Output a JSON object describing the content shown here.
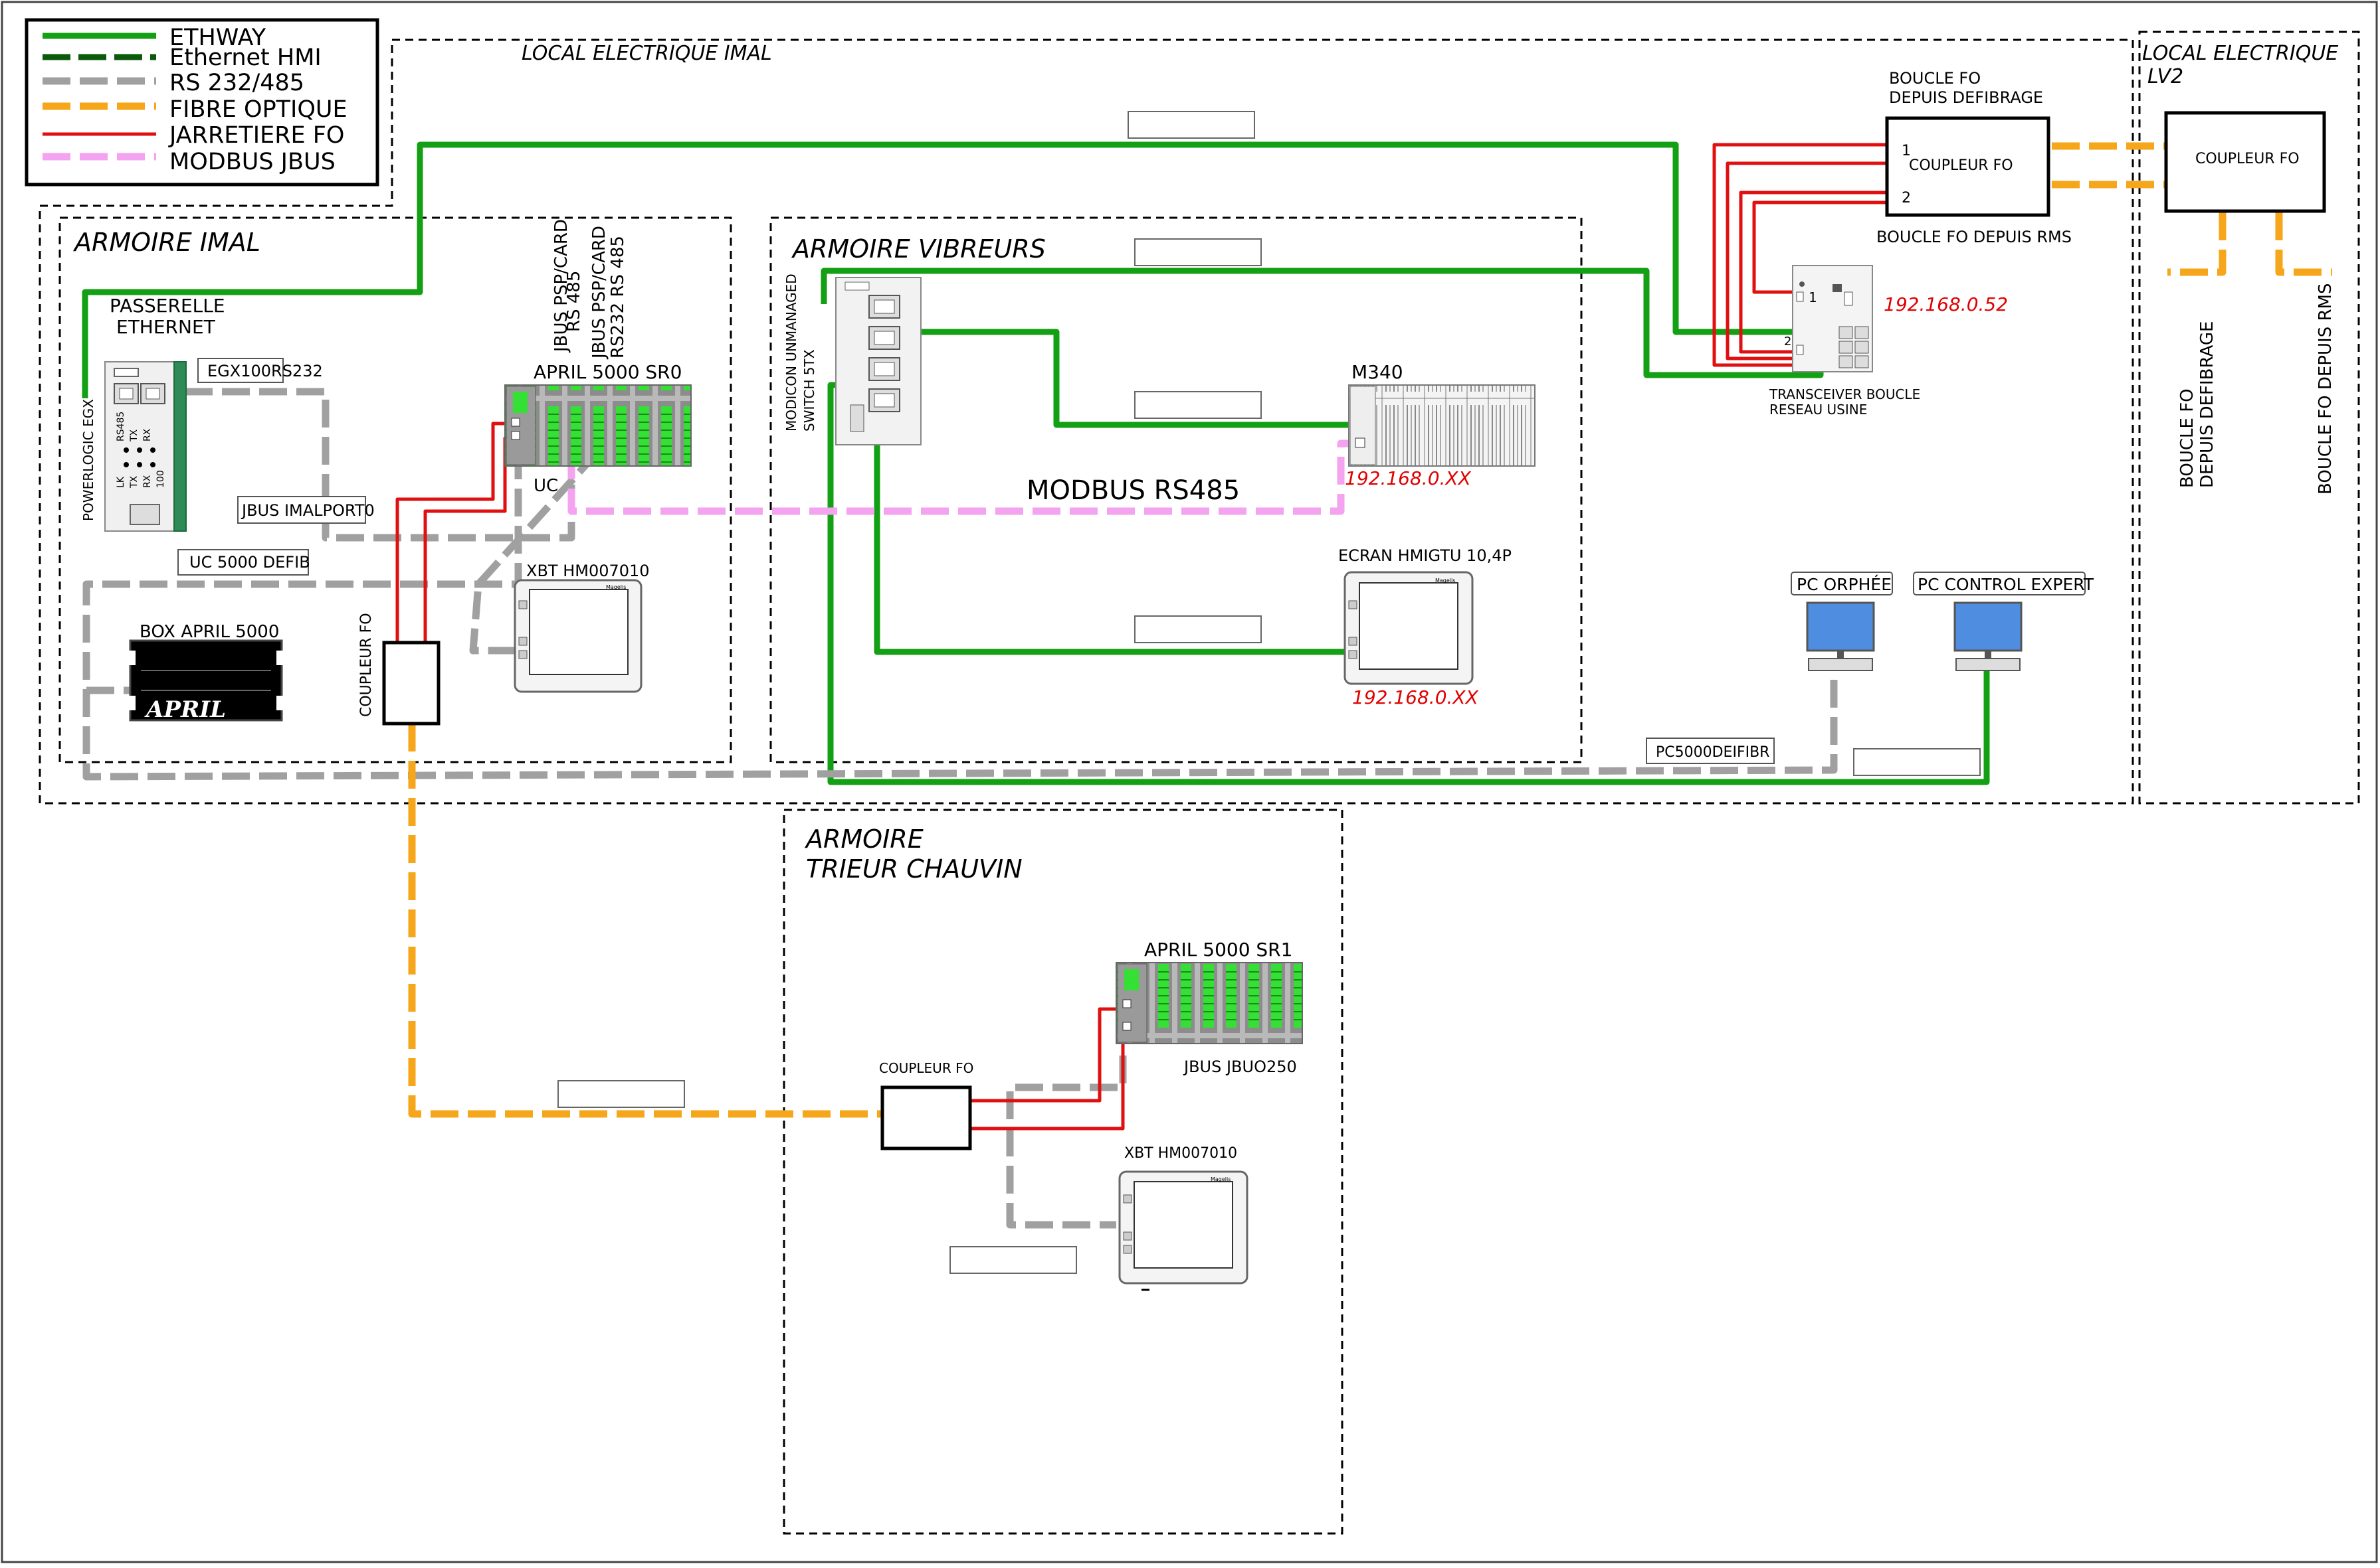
{
  "colors": {
    "ethway": "#14a014",
    "ethernet_hmi": "#0b5a0b",
    "rs232_485": "#a0a0a0",
    "fibre_optique": "#f5a61a",
    "jarretiere_fo": "#e01010",
    "modbus_jbus": "#f4a3f0",
    "ip_text": "#e00000"
  },
  "legend": {
    "ethway": "ETHWAY",
    "ethernet_hmi": "Ethernet HMI",
    "rs232_485": "RS 232/485",
    "fibre_optique": "FIBRE OPTIQUE",
    "jarretiere_fo": "JARRETIERE FO",
    "modbus_jbus": "MODBUS JBUS"
  },
  "zones": {
    "local_imal": "LOCAL ELECTRIQUE IMAL",
    "local_lv2_line1": "LOCAL ELECTRIQUE",
    "local_lv2_line2": "LV2",
    "armoire_imal": "ARMOIRE IMAL",
    "armoire_vibreurs": "ARMOIRE VIBREURS",
    "armoire_trieur_line1": "ARMOIRE",
    "armoire_trieur_line2": "TRIEUR CHAUVIN"
  },
  "labels": {
    "passerelle_line1": "PASSERELLE",
    "passerelle_line2": "ETHERNET",
    "egx100": "EGX100RS232",
    "powerlogic": "POWERLOGIC EGX",
    "egx_rs485": "RS485",
    "egx_tx": "TX",
    "egx_rx": "RX",
    "egx_lk": "LK",
    "egx_100": "100",
    "jbus_imalport": "JBUS IMALPORT0",
    "uc5000_defib": "UC 5000 DEFIB",
    "box_april": "BOX APRIL 5000",
    "april_logo": "APRIL",
    "jbus_psp_rs485_line1": "JBUS PSP/CARD",
    "jbus_psp_rs485_line2": "RS 485",
    "jbus_psp_rs232_line1": "JBUS PSP/CARD",
    "jbus_psp_rs232_line2": "RS232  RS 485",
    "april_sr0": "APRIL 5000 SR0",
    "uc": "UC",
    "xbt_hm_1": "XBT HM007010",
    "coupleur_fo_vertical": "COUPLEUR FO",
    "modicon_line1": "MODICON UNMANAGED",
    "modicon_line2": "SWITCH 5TX",
    "m340": "M340",
    "modbus_rs485": "MODBUS RS485",
    "ip_m340": "192.168.0.XX",
    "ecran_hmi": "ECRAN HMIGTU 10,4P",
    "ip_hmi": "192.168.0.XX",
    "boucle_fo_defib_line1": "BOUCLE FO",
    "boucle_fo_defib_line2": "DEPUIS DEFIBRAGE",
    "coupleur_fo": "COUPLEUR FO",
    "port_1": "1",
    "port_2": "2",
    "boucle_fo_rms": "BOUCLE FO DEPUIS RMS",
    "ip_transceiver": "192.168.0.52",
    "transceiver_line1": "TRANSCEIVER BOUCLE",
    "transceiver_line2": "RESEAU USINE",
    "pc_orphee": "PC ORPHÉE",
    "pc_control_expert": "PC CONTROL EXPERT",
    "pc5000deifibr": "PC5000DEIFIBR",
    "lv2_coupleur_fo": "COUPLEUR FO",
    "lv2_boucle_defib_line1": "BOUCLE FO",
    "lv2_boucle_defib_line2": "DEPUIS DEFIBRAGE",
    "lv2_boucle_rms": "BOUCLE FO DEPUIS RMS",
    "april_sr1": "APRIL 5000 SR1",
    "jbus_jbuo250": "JBUS JBUO250",
    "coupleur_fo_trieur": "COUPLEUR FO",
    "xbt_hm_2": "XBT HM007010",
    "magelis": "Magelis"
  }
}
